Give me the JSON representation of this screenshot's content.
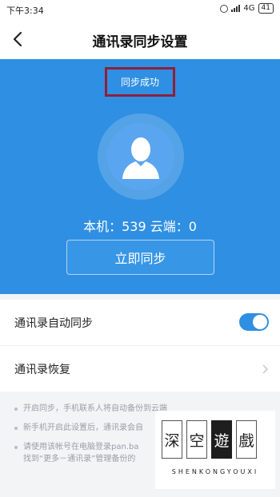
{
  "status_bar": {
    "time": "下午3:34",
    "network": "4G",
    "battery": "41"
  },
  "nav": {
    "title": "通讯录同步设置",
    "back_icon": "chevron-left-icon"
  },
  "hero": {
    "sync_status": "同步成功",
    "avatar_icon": "person-silhouette-icon",
    "counts_text": "本机：539  云端：0",
    "sync_button_label": "立即同步",
    "colors": {
      "background": "#2f8fe2",
      "highlight_box": "#8e2038"
    }
  },
  "settings": {
    "items": [
      {
        "label": "通讯录自动同步",
        "control": "toggle",
        "toggle_on": true
      },
      {
        "label": "通讯录恢复",
        "control": "chevron-right-icon"
      }
    ]
  },
  "tips": [
    "开启同步，手机联系人将自动备份到云端",
    "新手机开启此设置后，通讯录会自",
    "请使用该帐号在电脑登录pan.ba",
    "找到“更多－通讯录”管理备份的"
  ],
  "watermark": {
    "chars": [
      "深",
      "空",
      "遊",
      "戲"
    ],
    "subtitle": "SHENKONGYOUXI"
  }
}
